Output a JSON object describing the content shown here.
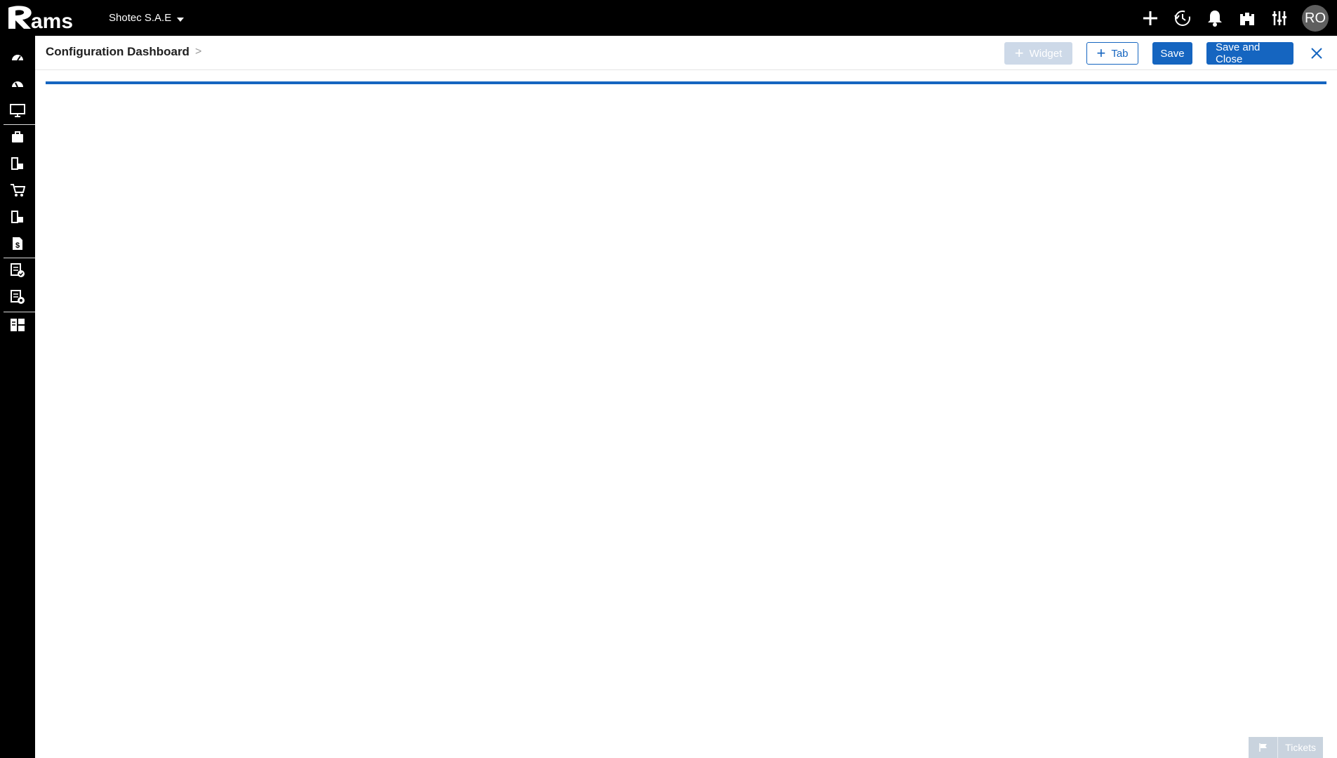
{
  "topbar": {
    "logo_text": "Rams",
    "company": "Shotec S.A.E",
    "icons": [
      "plus-icon",
      "history-icon",
      "bell-icon",
      "castle-icon",
      "sliders-icon"
    ],
    "avatar_initials": "RO"
  },
  "sidebar": {
    "items": [
      "gauge-icon",
      "gauge-alt-icon",
      "monitor-icon",
      "briefcase-icon",
      "modules-icon",
      "cart-icon",
      "modules-alt-icon",
      "invoice-dollar-icon",
      "document-check-icon",
      "document-gear-icon",
      "dashboard-grid-icon"
    ]
  },
  "header": {
    "breadcrumb": "Configuration Dashboard",
    "breadcrumb_sep": ">"
  },
  "actions": {
    "widget_label": "Widget",
    "tab_label": "Tab",
    "save_label": "Save",
    "save_close_label": "Save and Close"
  },
  "footer": {
    "tickets_label": "Tickets"
  },
  "colors": {
    "primary": "#1565c0",
    "disabled": "#cdd9e8",
    "topbar": "#000000"
  }
}
